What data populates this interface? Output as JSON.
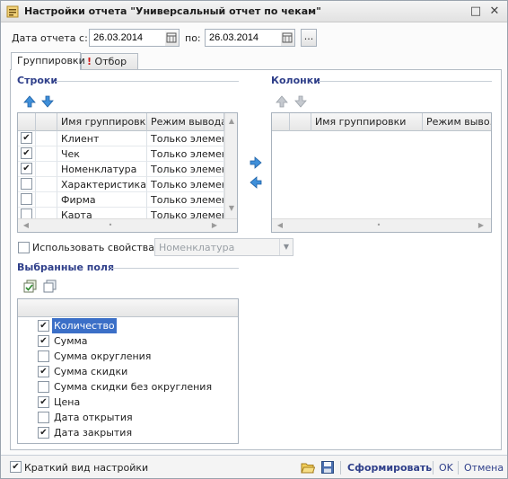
{
  "window": {
    "title": "Настройки отчета \"Универсальный отчет по чекам\""
  },
  "period": {
    "from_label": "Дата отчета с:",
    "from_value": "26.03.2014",
    "to_label": "по:",
    "to_value": "26.03.2014",
    "dots_label": "..."
  },
  "tabs": [
    {
      "label": "Группировки"
    },
    {
      "label": "Отбор",
      "marker": "!"
    }
  ],
  "rows_section": {
    "title": "Строки",
    "columns": [
      "Имя группировки",
      "Режим вывода"
    ],
    "items": [
      {
        "name": "Клиент",
        "mode": "Только элементы",
        "checked": true
      },
      {
        "name": "Чек",
        "mode": "Только элементы",
        "checked": true
      },
      {
        "name": "Номенклатура",
        "mode": "Только элементы",
        "checked": true
      },
      {
        "name": "Характеристика...",
        "mode": "Только элементы",
        "checked": false
      },
      {
        "name": "Фирма",
        "mode": "Только элементы",
        "checked": false
      },
      {
        "name": "Карта",
        "mode": "Только элементы",
        "checked": false
      }
    ]
  },
  "columns_section": {
    "title": "Колонки",
    "columns": [
      "Имя группировки",
      "Режим выво..."
    ]
  },
  "use_properties": {
    "label": "Использовать свойства",
    "checked": false,
    "select_value": "Номенклатура"
  },
  "selected_fields": {
    "title": "Выбранные поля",
    "items": [
      {
        "label": "Количество",
        "checked": true,
        "selected": true
      },
      {
        "label": "Сумма",
        "checked": true
      },
      {
        "label": "Сумма округления",
        "checked": false
      },
      {
        "label": "Сумма скидки",
        "checked": true
      },
      {
        "label": "Сумма скидки без округления",
        "checked": false
      },
      {
        "label": "Цена",
        "checked": true
      },
      {
        "label": "Дата открытия",
        "checked": false
      },
      {
        "label": "Дата закрытия",
        "checked": true
      }
    ]
  },
  "footer": {
    "short_view_label": "Краткий вид настройки",
    "short_view_checked": true,
    "generate_label": "Сформировать",
    "ok_label": "OK",
    "cancel_label": "Отмена"
  },
  "colors": {
    "accent": "#2f3f8a",
    "selection": "#3b6fc7"
  }
}
